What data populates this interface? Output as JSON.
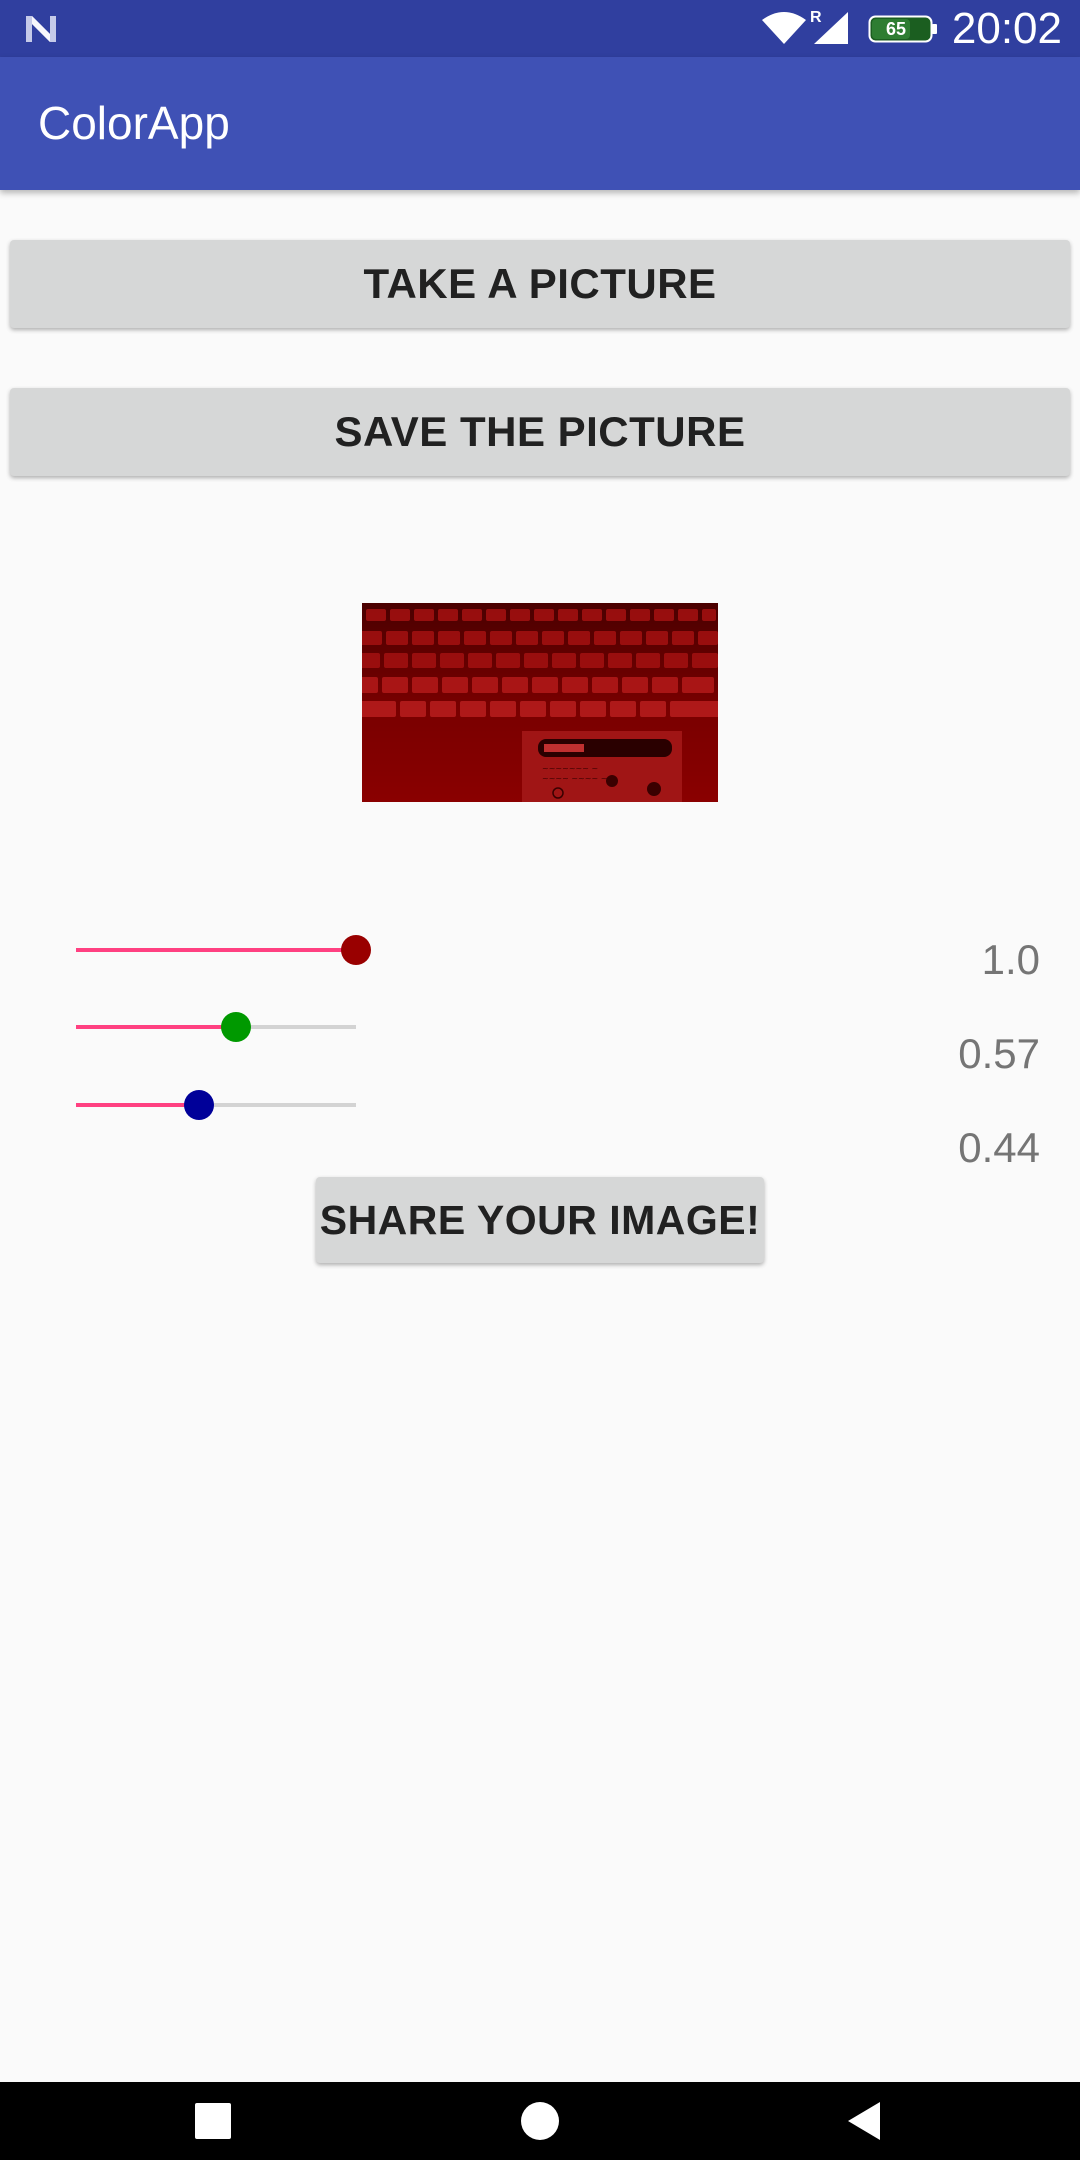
{
  "status_bar": {
    "time": "20:02",
    "battery_level": "65",
    "icons": [
      "n-notification-icon",
      "wifi-icon",
      "signal-icon",
      "battery-icon"
    ]
  },
  "app_bar": {
    "title": "ColorApp"
  },
  "buttons": {
    "take_picture": "TAKE A PICTURE",
    "save_picture": "SAVE THE PICTURE",
    "share_image": "SHARE YOUR IMAGE!"
  },
  "sliders": [
    {
      "channel": "red",
      "value": 1.0,
      "label": "1.0",
      "thumb_color": "#990000"
    },
    {
      "channel": "green",
      "value": 0.57,
      "label": "0.57",
      "thumb_color": "#009900"
    },
    {
      "channel": "blue",
      "value": 0.44,
      "label": "0.44",
      "thumb_color": "#000099"
    }
  ],
  "colors": {
    "status_bar": "#303f9f",
    "app_bar": "#3f51b5",
    "slider_active": "#ff4081",
    "slider_inactive": "#d3d3d3",
    "button_bg": "#d6d7d7",
    "value_text": "#757575"
  },
  "nav_bar": {
    "icons": [
      "recents-icon",
      "home-icon",
      "back-icon"
    ]
  }
}
